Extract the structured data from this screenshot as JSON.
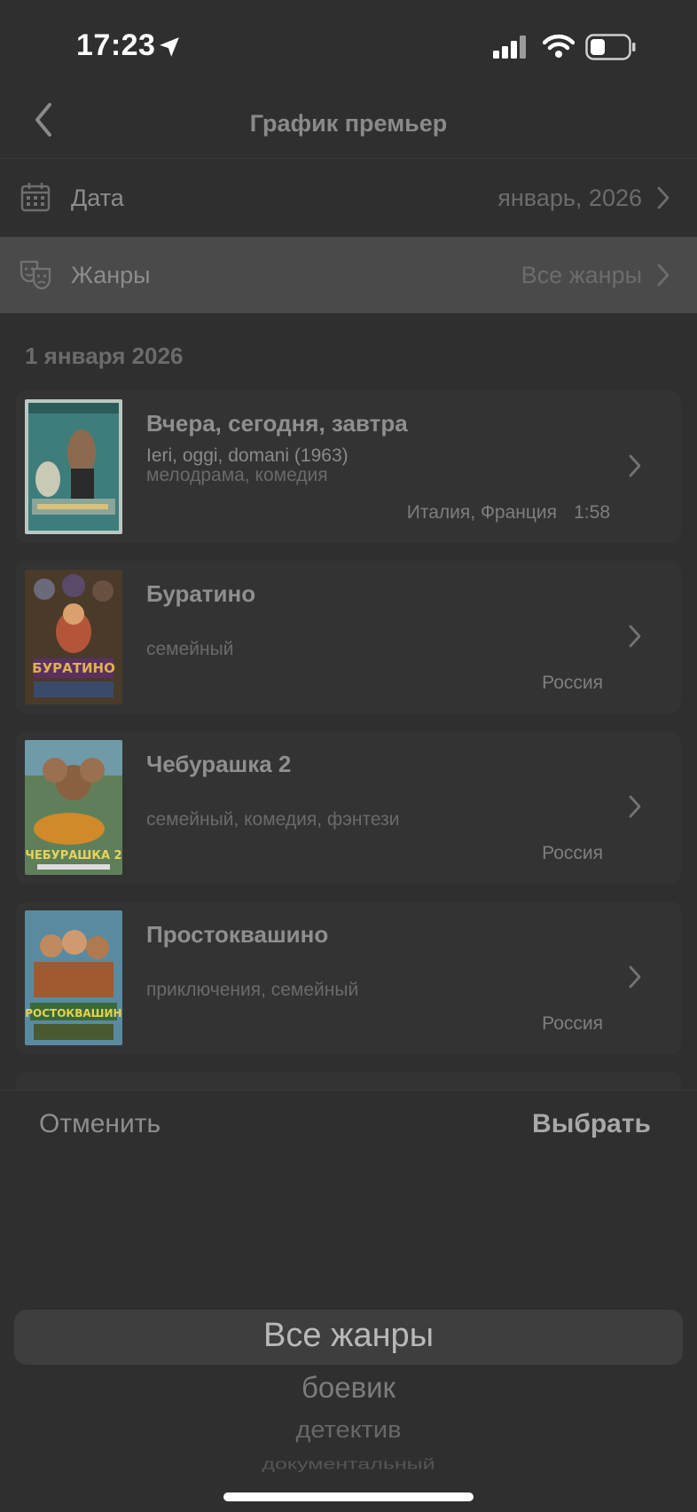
{
  "status_bar": {
    "time": "17:23"
  },
  "nav": {
    "title": "График премьер"
  },
  "filters": {
    "date": {
      "label": "Дата",
      "value": "январь, 2026"
    },
    "genre": {
      "label": "Жанры",
      "value": "Все жанры"
    }
  },
  "section": {
    "date_header": "1 января 2026"
  },
  "movies": [
    {
      "title": "Вчера, сегодня, завтра",
      "original": "Ieri, oggi, domani (1963)",
      "genres": "мелодрама, комедия",
      "country": "Италия, Франция",
      "duration": "1:58"
    },
    {
      "title": "Буратино",
      "original": "",
      "genres": "семейный",
      "country": "Россия",
      "duration": ""
    },
    {
      "title": "Чебурашка 2",
      "original": "",
      "genres": "семейный, комедия, фэнтези",
      "country": "Россия",
      "duration": ""
    },
    {
      "title": "Простоквашино",
      "original": "",
      "genres": "приключения, семейный",
      "country": "Россия",
      "duration": ""
    }
  ],
  "picker": {
    "cancel_label": "Отменить",
    "select_label": "Выбрать",
    "options": [
      "Все жанры",
      "боевик",
      "детектив",
      "документальный"
    ]
  },
  "colors": {
    "background": "#2f2f2f",
    "highlight_row": "#4a4a4a",
    "card": "#333333"
  }
}
